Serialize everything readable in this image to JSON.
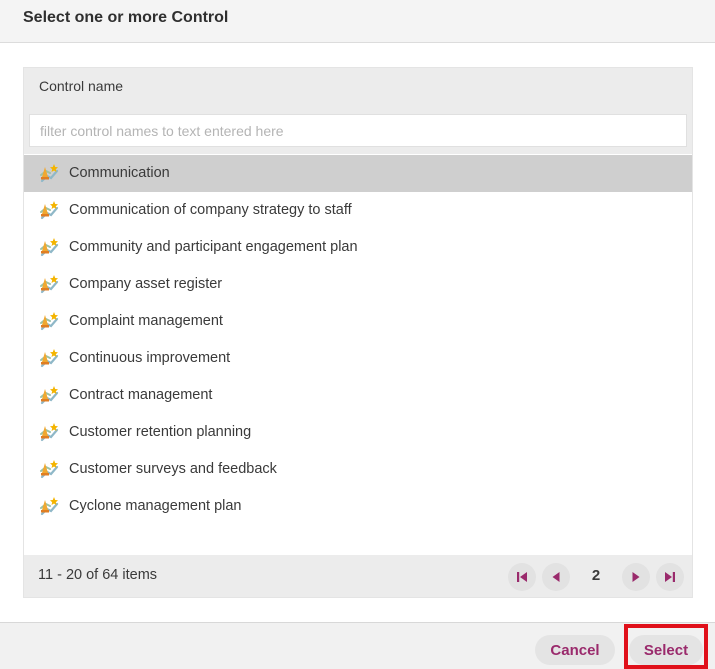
{
  "dialog": {
    "title": "Select one or more Control"
  },
  "grid": {
    "column_title": "Control name",
    "filter_placeholder": "filter control names to text entered here",
    "items": [
      {
        "label": "Communication",
        "selected": true
      },
      {
        "label": "Communication of company strategy to staff",
        "selected": false
      },
      {
        "label": "Community and participant engagement plan",
        "selected": false
      },
      {
        "label": "Company asset register",
        "selected": false
      },
      {
        "label": "Complaint management",
        "selected": false
      },
      {
        "label": "Continuous improvement",
        "selected": false
      },
      {
        "label": "Contract management",
        "selected": false
      },
      {
        "label": "Customer retention planning",
        "selected": false
      },
      {
        "label": "Customer surveys and feedback",
        "selected": false
      },
      {
        "label": "Cyclone management plan",
        "selected": false
      }
    ],
    "item_icon": "control-icon"
  },
  "pager": {
    "info": "11 - 20 of 64 items",
    "current_page": "2",
    "icons": [
      "first-page-icon",
      "previous-page-icon",
      "next-page-icon",
      "last-page-icon"
    ]
  },
  "footer": {
    "cancel_label": "Cancel",
    "select_label": "Select"
  },
  "colors": {
    "accent": "#9a2a6c",
    "selected_row": "#cfcfcf",
    "highlight": "#e0101a"
  }
}
